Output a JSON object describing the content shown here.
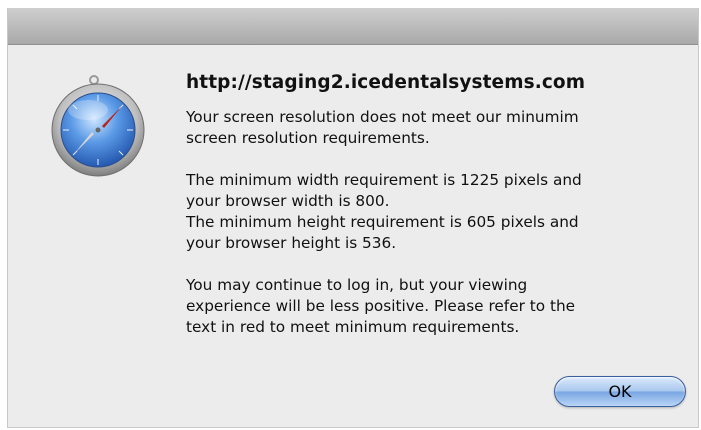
{
  "dialog": {
    "title": "http://staging2.icedentalsystems.com",
    "message_1": "Your screen resolution does not meet our minumim\nscreen resolution requirements.",
    "message_2": "The minimum width requirement is 1225 pixels and\nyour browser width is 800.\nThe minimum height requirement is 605 pixels and\nyour browser height is 536.",
    "message_3": "You may continue to log in, but your viewing\nexperience will be less positive.  Please refer to the\ntext in red to meet minimum requirements.",
    "ok_label": "OK",
    "icon": "safari-compass-icon"
  }
}
